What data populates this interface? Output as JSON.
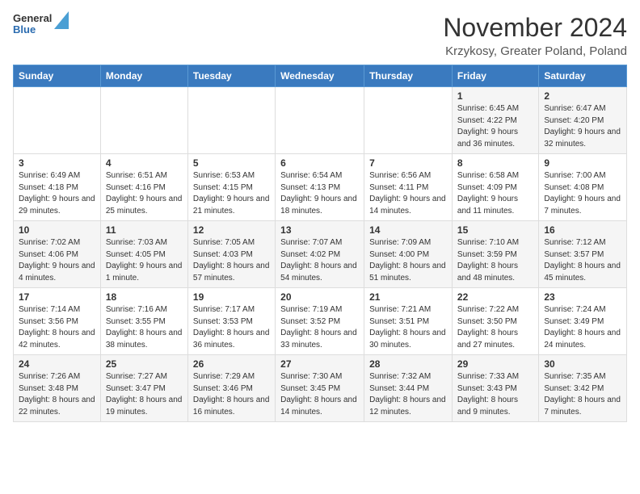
{
  "logo": {
    "general": "General",
    "blue": "Blue"
  },
  "header": {
    "month": "November 2024",
    "location": "Krzykosy, Greater Poland, Poland"
  },
  "weekdays": [
    "Sunday",
    "Monday",
    "Tuesday",
    "Wednesday",
    "Thursday",
    "Friday",
    "Saturday"
  ],
  "weeks": [
    [
      {
        "day": "",
        "info": ""
      },
      {
        "day": "",
        "info": ""
      },
      {
        "day": "",
        "info": ""
      },
      {
        "day": "",
        "info": ""
      },
      {
        "day": "",
        "info": ""
      },
      {
        "day": "1",
        "info": "Sunrise: 6:45 AM\nSunset: 4:22 PM\nDaylight: 9 hours and 36 minutes."
      },
      {
        "day": "2",
        "info": "Sunrise: 6:47 AM\nSunset: 4:20 PM\nDaylight: 9 hours and 32 minutes."
      }
    ],
    [
      {
        "day": "3",
        "info": "Sunrise: 6:49 AM\nSunset: 4:18 PM\nDaylight: 9 hours and 29 minutes."
      },
      {
        "day": "4",
        "info": "Sunrise: 6:51 AM\nSunset: 4:16 PM\nDaylight: 9 hours and 25 minutes."
      },
      {
        "day": "5",
        "info": "Sunrise: 6:53 AM\nSunset: 4:15 PM\nDaylight: 9 hours and 21 minutes."
      },
      {
        "day": "6",
        "info": "Sunrise: 6:54 AM\nSunset: 4:13 PM\nDaylight: 9 hours and 18 minutes."
      },
      {
        "day": "7",
        "info": "Sunrise: 6:56 AM\nSunset: 4:11 PM\nDaylight: 9 hours and 14 minutes."
      },
      {
        "day": "8",
        "info": "Sunrise: 6:58 AM\nSunset: 4:09 PM\nDaylight: 9 hours and 11 minutes."
      },
      {
        "day": "9",
        "info": "Sunrise: 7:00 AM\nSunset: 4:08 PM\nDaylight: 9 hours and 7 minutes."
      }
    ],
    [
      {
        "day": "10",
        "info": "Sunrise: 7:02 AM\nSunset: 4:06 PM\nDaylight: 9 hours and 4 minutes."
      },
      {
        "day": "11",
        "info": "Sunrise: 7:03 AM\nSunset: 4:05 PM\nDaylight: 9 hours and 1 minute."
      },
      {
        "day": "12",
        "info": "Sunrise: 7:05 AM\nSunset: 4:03 PM\nDaylight: 8 hours and 57 minutes."
      },
      {
        "day": "13",
        "info": "Sunrise: 7:07 AM\nSunset: 4:02 PM\nDaylight: 8 hours and 54 minutes."
      },
      {
        "day": "14",
        "info": "Sunrise: 7:09 AM\nSunset: 4:00 PM\nDaylight: 8 hours and 51 minutes."
      },
      {
        "day": "15",
        "info": "Sunrise: 7:10 AM\nSunset: 3:59 PM\nDaylight: 8 hours and 48 minutes."
      },
      {
        "day": "16",
        "info": "Sunrise: 7:12 AM\nSunset: 3:57 PM\nDaylight: 8 hours and 45 minutes."
      }
    ],
    [
      {
        "day": "17",
        "info": "Sunrise: 7:14 AM\nSunset: 3:56 PM\nDaylight: 8 hours and 42 minutes."
      },
      {
        "day": "18",
        "info": "Sunrise: 7:16 AM\nSunset: 3:55 PM\nDaylight: 8 hours and 38 minutes."
      },
      {
        "day": "19",
        "info": "Sunrise: 7:17 AM\nSunset: 3:53 PM\nDaylight: 8 hours and 36 minutes."
      },
      {
        "day": "20",
        "info": "Sunrise: 7:19 AM\nSunset: 3:52 PM\nDaylight: 8 hours and 33 minutes."
      },
      {
        "day": "21",
        "info": "Sunrise: 7:21 AM\nSunset: 3:51 PM\nDaylight: 8 hours and 30 minutes."
      },
      {
        "day": "22",
        "info": "Sunrise: 7:22 AM\nSunset: 3:50 PM\nDaylight: 8 hours and 27 minutes."
      },
      {
        "day": "23",
        "info": "Sunrise: 7:24 AM\nSunset: 3:49 PM\nDaylight: 8 hours and 24 minutes."
      }
    ],
    [
      {
        "day": "24",
        "info": "Sunrise: 7:26 AM\nSunset: 3:48 PM\nDaylight: 8 hours and 22 minutes."
      },
      {
        "day": "25",
        "info": "Sunrise: 7:27 AM\nSunset: 3:47 PM\nDaylight: 8 hours and 19 minutes."
      },
      {
        "day": "26",
        "info": "Sunrise: 7:29 AM\nSunset: 3:46 PM\nDaylight: 8 hours and 16 minutes."
      },
      {
        "day": "27",
        "info": "Sunrise: 7:30 AM\nSunset: 3:45 PM\nDaylight: 8 hours and 14 minutes."
      },
      {
        "day": "28",
        "info": "Sunrise: 7:32 AM\nSunset: 3:44 PM\nDaylight: 8 hours and 12 minutes."
      },
      {
        "day": "29",
        "info": "Sunrise: 7:33 AM\nSunset: 3:43 PM\nDaylight: 8 hours and 9 minutes."
      },
      {
        "day": "30",
        "info": "Sunrise: 7:35 AM\nSunset: 3:42 PM\nDaylight: 8 hours and 7 minutes."
      }
    ]
  ]
}
